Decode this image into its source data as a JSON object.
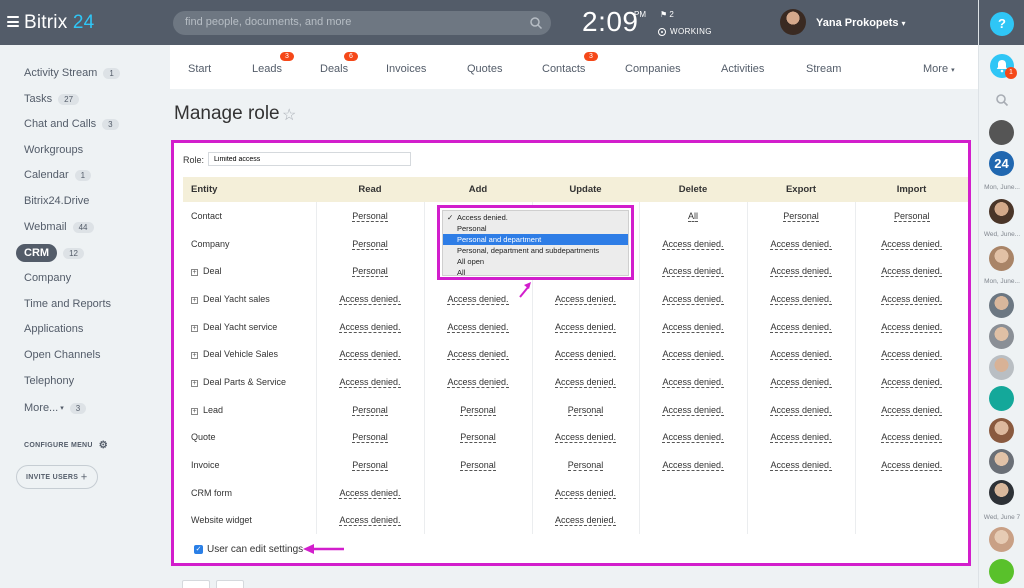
{
  "app": {
    "logo_text": "Bitrix",
    "logo_num": "24"
  },
  "search": {
    "placeholder": "find people, documents, and more"
  },
  "clock": {
    "time": "2:09",
    "ampm": "PM",
    "flag_count": "2",
    "status": "WORKING"
  },
  "user": {
    "name": "Yana Prokopets"
  },
  "help": "?",
  "notifications": {
    "count": "1"
  },
  "sidebar": {
    "items": [
      {
        "label": "Activity Stream",
        "count": "1"
      },
      {
        "label": "Tasks",
        "count": "27"
      },
      {
        "label": "Chat and Calls",
        "count": "3"
      },
      {
        "label": "Workgroups",
        "count": ""
      },
      {
        "label": "Calendar",
        "count": "1"
      },
      {
        "label": "Bitrix24.Drive",
        "count": ""
      },
      {
        "label": "Webmail",
        "count": "44"
      },
      {
        "label": "CRM",
        "count": "12"
      },
      {
        "label": "Company",
        "count": ""
      },
      {
        "label": "Time and Reports",
        "count": ""
      },
      {
        "label": "Applications",
        "count": ""
      },
      {
        "label": "Open Channels",
        "count": ""
      },
      {
        "label": "Telephony",
        "count": ""
      },
      {
        "label": "More...",
        "count": "3"
      }
    ],
    "configure": "CONFIGURE MENU",
    "invite": "INVITE USERS"
  },
  "tabs": [
    {
      "label": "Start",
      "badge": ""
    },
    {
      "label": "Leads",
      "badge": "3"
    },
    {
      "label": "Deals",
      "badge": "6"
    },
    {
      "label": "Invoices",
      "badge": ""
    },
    {
      "label": "Quotes",
      "badge": ""
    },
    {
      "label": "Contacts",
      "badge": "3"
    },
    {
      "label": "Companies",
      "badge": ""
    },
    {
      "label": "Activities",
      "badge": ""
    },
    {
      "label": "Stream",
      "badge": ""
    },
    {
      "label": "More",
      "badge": ""
    }
  ],
  "page": {
    "title": "Manage role"
  },
  "role": {
    "label": "Role:",
    "value": "Limited access"
  },
  "table": {
    "headers": [
      "Entity",
      "Read",
      "Add",
      "Update",
      "Delete",
      "Export",
      "Import"
    ],
    "rows": [
      {
        "entity": "Contact",
        "expand": false,
        "cells": [
          "Personal",
          "",
          "",
          "All",
          "Personal",
          "Personal"
        ]
      },
      {
        "entity": "Company",
        "expand": false,
        "cells": [
          "Personal",
          "",
          "",
          "Access denied.",
          "Access denied.",
          "Access denied."
        ]
      },
      {
        "entity": "Deal",
        "expand": true,
        "cells": [
          "Personal",
          "",
          "",
          "Access denied.",
          "Access denied.",
          "Access denied."
        ]
      },
      {
        "entity": "Deal Yacht sales",
        "expand": true,
        "cells": [
          "Access denied.",
          "Access denied.",
          "Access denied.",
          "Access denied.",
          "Access denied.",
          "Access denied."
        ]
      },
      {
        "entity": "Deal Yacht service",
        "expand": true,
        "cells": [
          "Access denied.",
          "Access denied.",
          "Access denied.",
          "Access denied.",
          "Access denied.",
          "Access denied."
        ]
      },
      {
        "entity": "Deal Vehicle Sales",
        "expand": true,
        "cells": [
          "Access denied.",
          "Access denied.",
          "Access denied.",
          "Access denied.",
          "Access denied.",
          "Access denied."
        ]
      },
      {
        "entity": "Deal Parts & Service",
        "expand": true,
        "cells": [
          "Access denied.",
          "Access denied.",
          "Access denied.",
          "Access denied.",
          "Access denied.",
          "Access denied."
        ]
      },
      {
        "entity": "Lead",
        "expand": true,
        "cells": [
          "Personal",
          "Personal",
          "Personal",
          "Access denied.",
          "Access denied.",
          "Access denied."
        ]
      },
      {
        "entity": "Quote",
        "expand": false,
        "cells": [
          "Personal",
          "Personal",
          "Access denied.",
          "Access denied.",
          "Access denied.",
          "Access denied."
        ]
      },
      {
        "entity": "Invoice",
        "expand": false,
        "cells": [
          "Personal",
          "Personal",
          "Personal",
          "Access denied.",
          "Access denied.",
          "Access denied."
        ]
      },
      {
        "entity": "CRM form",
        "expand": false,
        "cells": [
          "Access denied.",
          "",
          "Access denied.",
          "",
          "",
          ""
        ]
      },
      {
        "entity": "Website widget",
        "expand": false,
        "cells": [
          "Access denied.",
          "",
          "Access denied.",
          "",
          "",
          ""
        ]
      }
    ]
  },
  "dropdown": {
    "options": [
      {
        "label": "Access denied.",
        "checked": true,
        "highlighted": false
      },
      {
        "label": "Personal",
        "checked": false,
        "highlighted": false
      },
      {
        "label": "Personal and department",
        "checked": false,
        "highlighted": true
      },
      {
        "label": "Personal, department and subdepartments",
        "checked": false,
        "highlighted": false
      },
      {
        "label": "All open",
        "checked": false,
        "highlighted": false
      },
      {
        "label": "All",
        "checked": false,
        "highlighted": false
      }
    ]
  },
  "settings": {
    "edit_settings_label": "User can edit settings",
    "checked": true
  },
  "rail": {
    "dates": [
      "Mon, June...",
      "Wed, June...",
      "Mon, June...",
      "Wed, June 7"
    ]
  },
  "colors": {
    "accent": "#2fc6f6",
    "highlight": "#d21ecc",
    "topbar": "#535c69",
    "badge": "#f54819"
  }
}
